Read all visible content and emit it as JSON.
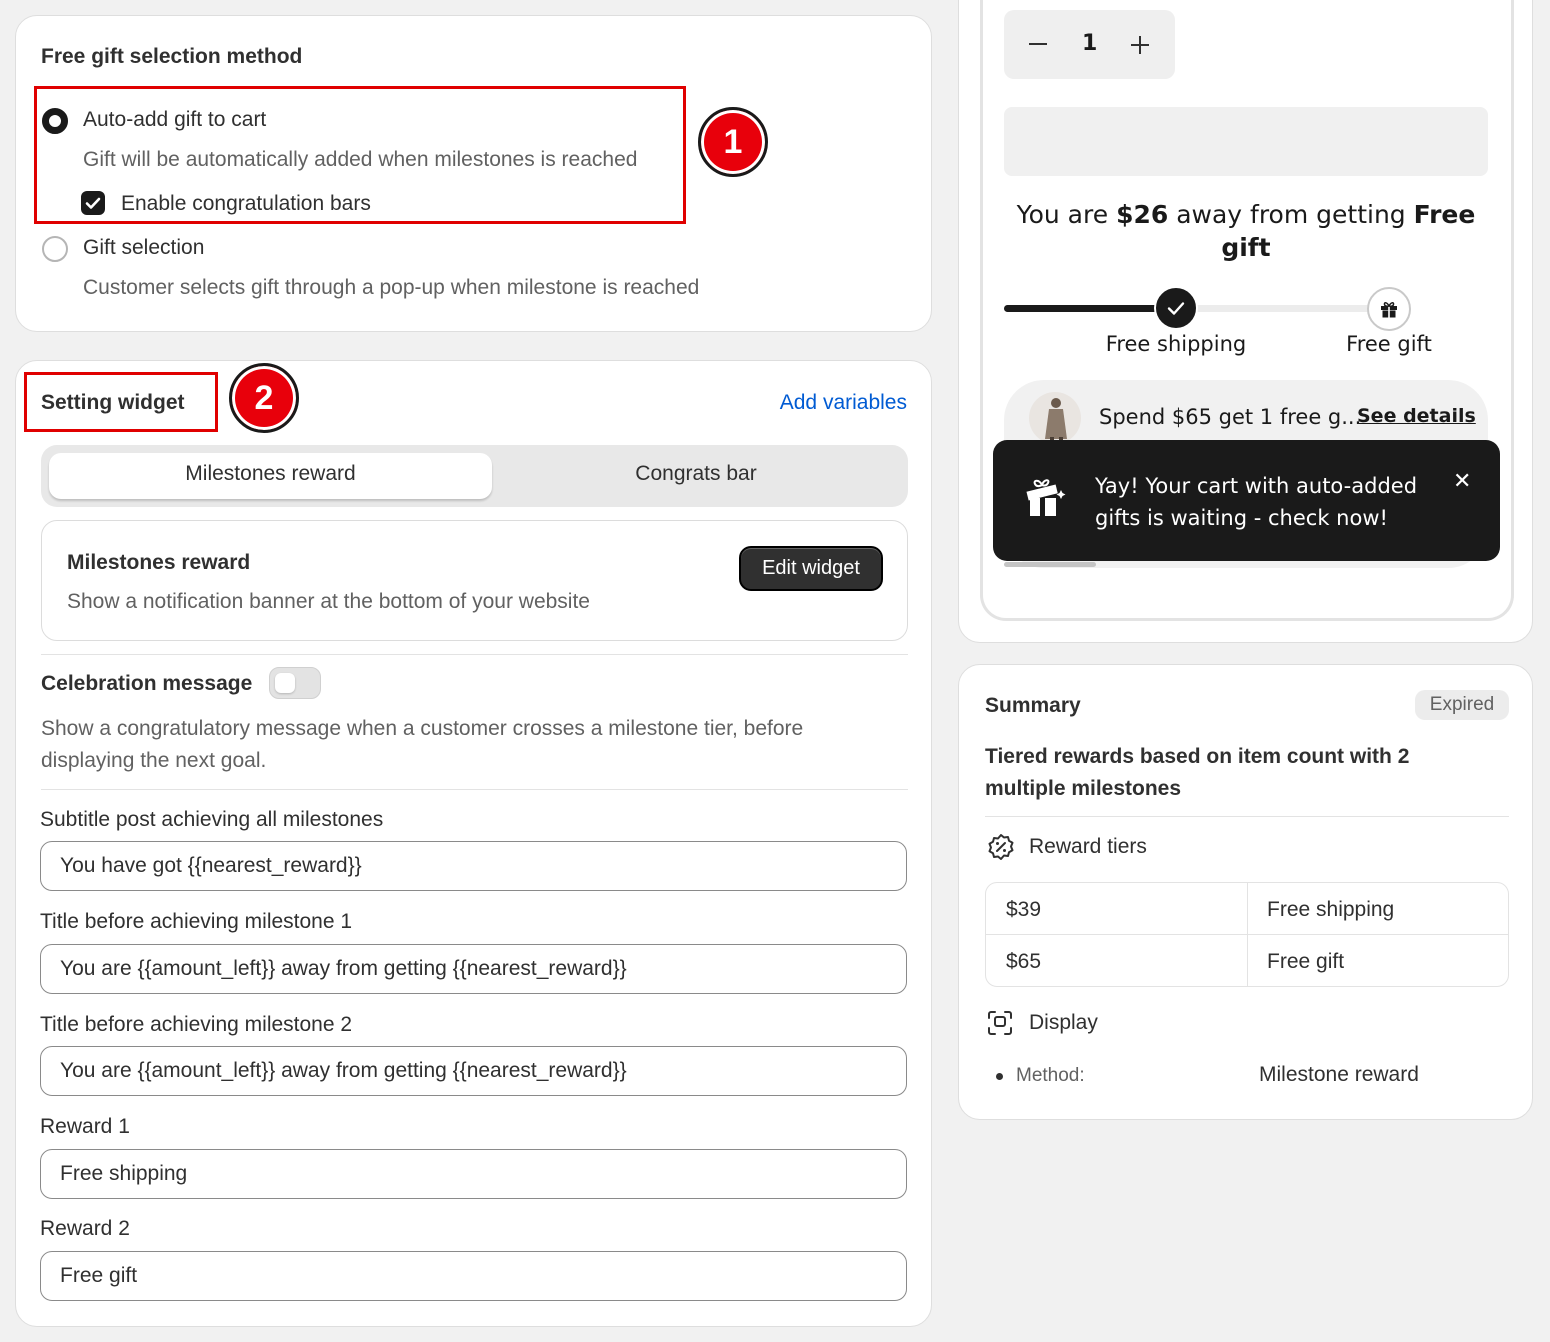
{
  "gift_method": {
    "title": "Free gift selection method",
    "auto_add": {
      "label": "Auto-add gift to cart",
      "description": "Gift will be automatically added when milestones is reached",
      "checkbox_label": "Enable congratulation bars",
      "selected": true,
      "checked": true
    },
    "gift_selection": {
      "label": "Gift selection",
      "description": "Customer selects gift through a pop-up when milestone is reached",
      "selected": false
    },
    "marker": "1"
  },
  "setting_widget": {
    "title": "Setting widget",
    "marker": "2",
    "add_variables": "Add variables",
    "tabs": [
      "Milestones reward",
      "Congrats bar"
    ],
    "active_tab": 0,
    "widget_card": {
      "title": "Milestones reward",
      "description": "Show a notification banner at the bottom of your website",
      "button": "Edit widget"
    },
    "celebration": {
      "title": "Celebration message",
      "enabled": false,
      "description_line1": "Show a congratulatory message when a customer crosses a milestone tier, before",
      "description_line2": "displaying the next goal."
    },
    "fields": [
      {
        "label": "Subtitle post achieving all milestones",
        "value": "You have got {{nearest_reward}}"
      },
      {
        "label": "Title before achieving milestone 1",
        "value": "You are {{amount_left}} away from getting {{nearest_reward}}"
      },
      {
        "label": "Title before achieving milestone 2",
        "value": "You are {{amount_left}} away from getting {{nearest_reward}}"
      },
      {
        "label": "Reward 1",
        "value": "Free shipping"
      },
      {
        "label": "Reward 2",
        "value": "Free gift"
      }
    ]
  },
  "preview": {
    "quantity": "1",
    "minus": "−",
    "plus": "+",
    "headline_line1_pre": "You are ",
    "headline_amount": "$26",
    "headline_line1_mid": " away from getting ",
    "headline_reward_1": "Free",
    "headline_reward_2": "gift",
    "progress": 0.5,
    "milestones": [
      "Free shipping",
      "Free gift"
    ],
    "offer_text": "Spend $65 get 1 free g...",
    "see_details": "See details",
    "toast_line1": "Yay! Your cart with auto-added",
    "toast_line2": "gifts is waiting - check now!",
    "toast_close": "✕"
  },
  "summary": {
    "title": "Summary",
    "status": "Expired",
    "description_line1": "Tiered rewards based on item count with 2",
    "description_line2": "multiple milestones",
    "reward_tiers_label": "Reward tiers",
    "tiers": [
      {
        "threshold": "$39",
        "reward": "Free shipping"
      },
      {
        "threshold": "$65",
        "reward": "Free gift"
      }
    ],
    "display_label": "Display",
    "method_label": "Method:",
    "method_value": "Milestone reward"
  },
  "colors": {
    "annotation_red": "#e00000",
    "link_blue": "#005bd3",
    "dark": "#1a1a1a"
  },
  "icons": [
    "minus-icon",
    "plus-icon",
    "check-icon",
    "gift-icon",
    "close-icon",
    "discount-badge-icon",
    "display-icon"
  ]
}
